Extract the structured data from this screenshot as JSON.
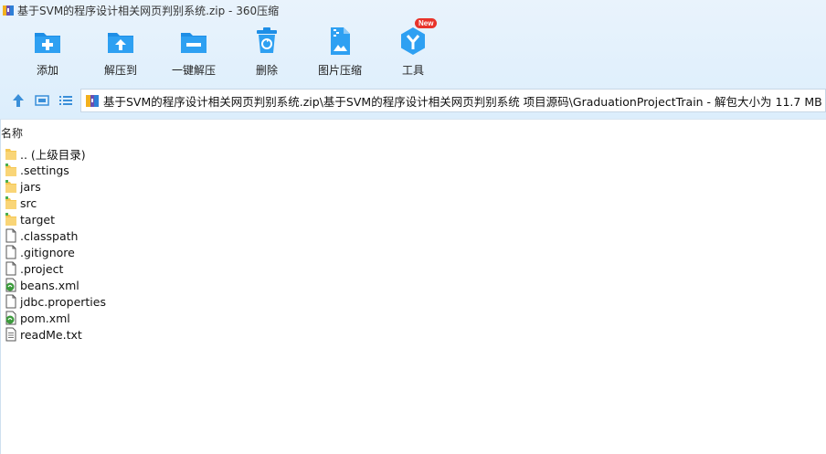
{
  "window": {
    "title": "基于SVM的程序设计相关网页判别系统.zip - 360压缩"
  },
  "toolbar": {
    "items": [
      {
        "label": "添加",
        "icon": "add-icon"
      },
      {
        "label": "解压到",
        "icon": "extract-to-icon"
      },
      {
        "label": "一键解压",
        "icon": "one-click-extract-icon"
      },
      {
        "label": "删除",
        "icon": "delete-icon"
      },
      {
        "label": "图片压缩",
        "icon": "image-compress-icon"
      },
      {
        "label": "工具",
        "icon": "tools-icon"
      }
    ],
    "new_badge": "New"
  },
  "nav": {
    "address": "基于SVM的程序设计相关网页判别系统.zip\\基于SVM的程序设计相关网页判别系统 项目源码\\GraduationProjectTrain - 解包大小为 11.7 MB"
  },
  "list": {
    "column_name": "名称",
    "rows": [
      {
        "name": ".. (上级目录)",
        "type": "folder-up"
      },
      {
        "name": ".settings",
        "type": "folder"
      },
      {
        "name": "jars",
        "type": "folder"
      },
      {
        "name": "src",
        "type": "folder"
      },
      {
        "name": "target",
        "type": "folder"
      },
      {
        "name": ".classpath",
        "type": "file"
      },
      {
        "name": ".gitignore",
        "type": "file"
      },
      {
        "name": ".project",
        "type": "file"
      },
      {
        "name": "beans.xml",
        "type": "xml"
      },
      {
        "name": "jdbc.properties",
        "type": "file"
      },
      {
        "name": "pom.xml",
        "type": "xml"
      },
      {
        "name": "readMe.txt",
        "type": "text"
      }
    ]
  },
  "colors": {
    "accent": "#1e8ee6",
    "folder": "#f5c753"
  }
}
